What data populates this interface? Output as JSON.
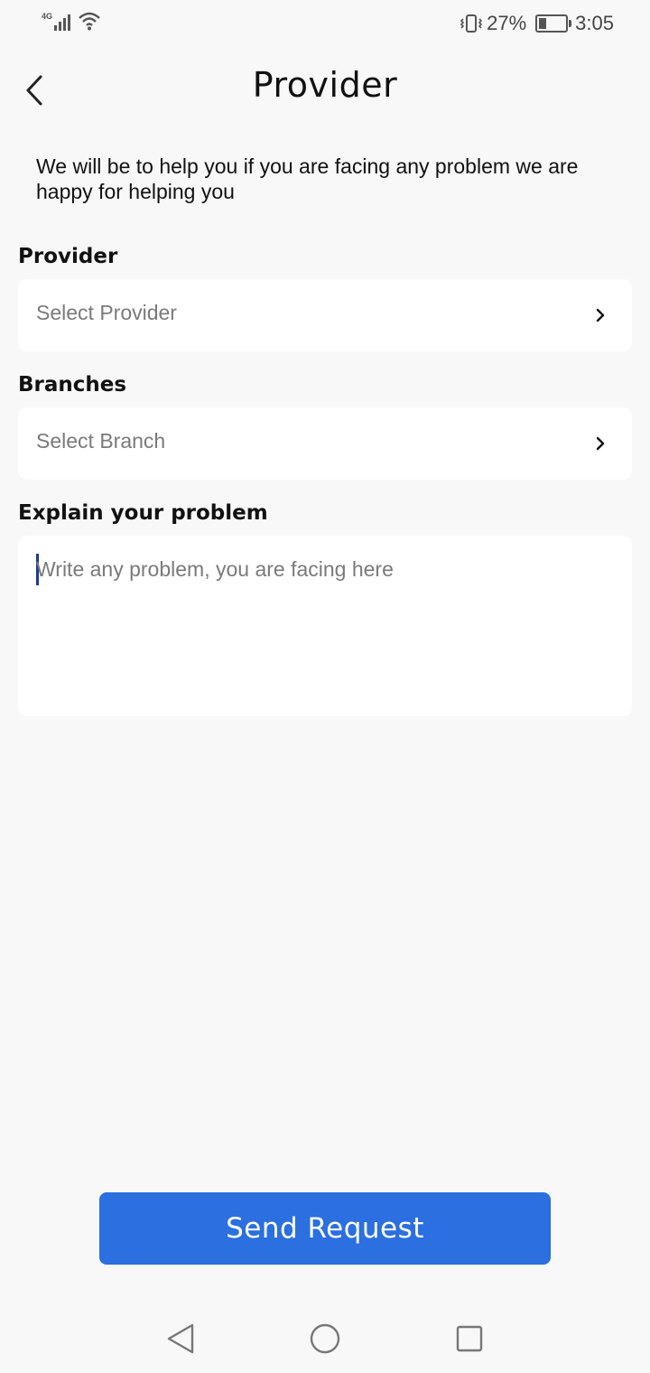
{
  "status_bar": {
    "network": "4G",
    "battery_percent": "27%",
    "battery_level": 0.27,
    "time": "3:05",
    "icons": [
      "signal-icon",
      "wifi-icon",
      "vibrate-icon",
      "battery-icon"
    ]
  },
  "header": {
    "title": "Provider",
    "back_icon": "chevron-left-icon"
  },
  "intro_text": "We will be to help you if you are facing any problem we are happy for helping you",
  "form": {
    "provider": {
      "label": "Provider",
      "placeholder": "Select Provider"
    },
    "branch": {
      "label": "Branches",
      "placeholder": "Select Branch"
    },
    "problem": {
      "label": "Explain your problem",
      "placeholder": "Write any problem, you are facing here",
      "value": ""
    }
  },
  "send_button": {
    "label": "Send Request",
    "color": "#2b6fe0"
  },
  "nav_bar": {
    "icons": [
      "nav-back-icon",
      "nav-home-icon",
      "nav-recents-icon"
    ]
  }
}
